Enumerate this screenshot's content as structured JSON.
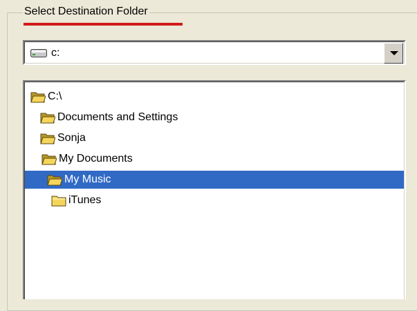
{
  "group": {
    "title": "Select Destination Folder"
  },
  "drive_combo": {
    "value": "c:",
    "icon": "drive-icon"
  },
  "tree": {
    "items": [
      {
        "label": "C:\\",
        "icon": "open-folder-icon",
        "level": 0,
        "selected": false
      },
      {
        "label": "Documents and Settings",
        "icon": "open-folder-icon",
        "level": 1,
        "selected": false
      },
      {
        "label": "Sonja",
        "icon": "open-folder-icon",
        "level": 2,
        "selected": false
      },
      {
        "label": "My Documents",
        "icon": "open-folder-icon",
        "level": 3,
        "selected": false
      },
      {
        "label": "My Music",
        "icon": "open-folder-icon",
        "level": 4,
        "selected": true
      },
      {
        "label": "iTunes",
        "icon": "closed-folder-icon",
        "level": 5,
        "selected": false
      }
    ]
  },
  "colors": {
    "selection": "#316ac5",
    "underline_accent": "#d11a1a",
    "folder": "#f5d55b"
  }
}
